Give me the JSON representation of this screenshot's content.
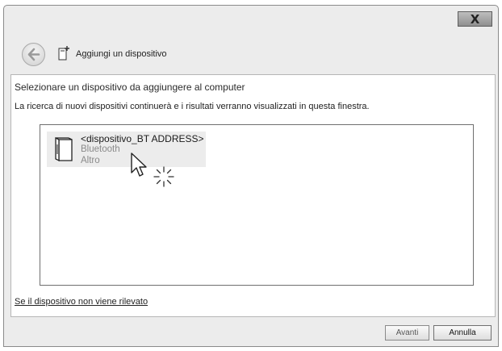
{
  "window": {
    "close_label": "X",
    "title": "Aggiungi un dispositivo"
  },
  "content": {
    "heading": "Selezionare un dispositivo da aggiungere al computer",
    "subtext": "La ricerca di nuovi dispositivi continuerà e i risultati verranno visualizzati in questa finestra."
  },
  "devices": [
    {
      "name": "<dispositivo_BT ADDRESS>",
      "type": "Bluetooth",
      "category": "Altro",
      "icon": "device-icon"
    }
  ],
  "footer": {
    "help_link": "Se il dispositivo non viene rilevato",
    "next_label": "Avanti",
    "cancel_label": "Annulla"
  },
  "colors": {
    "window_bg": "#ececec",
    "panel_bg": "#ffffff",
    "selected_item_bg": "#ececec",
    "secondary_text": "#8a8a8a"
  }
}
